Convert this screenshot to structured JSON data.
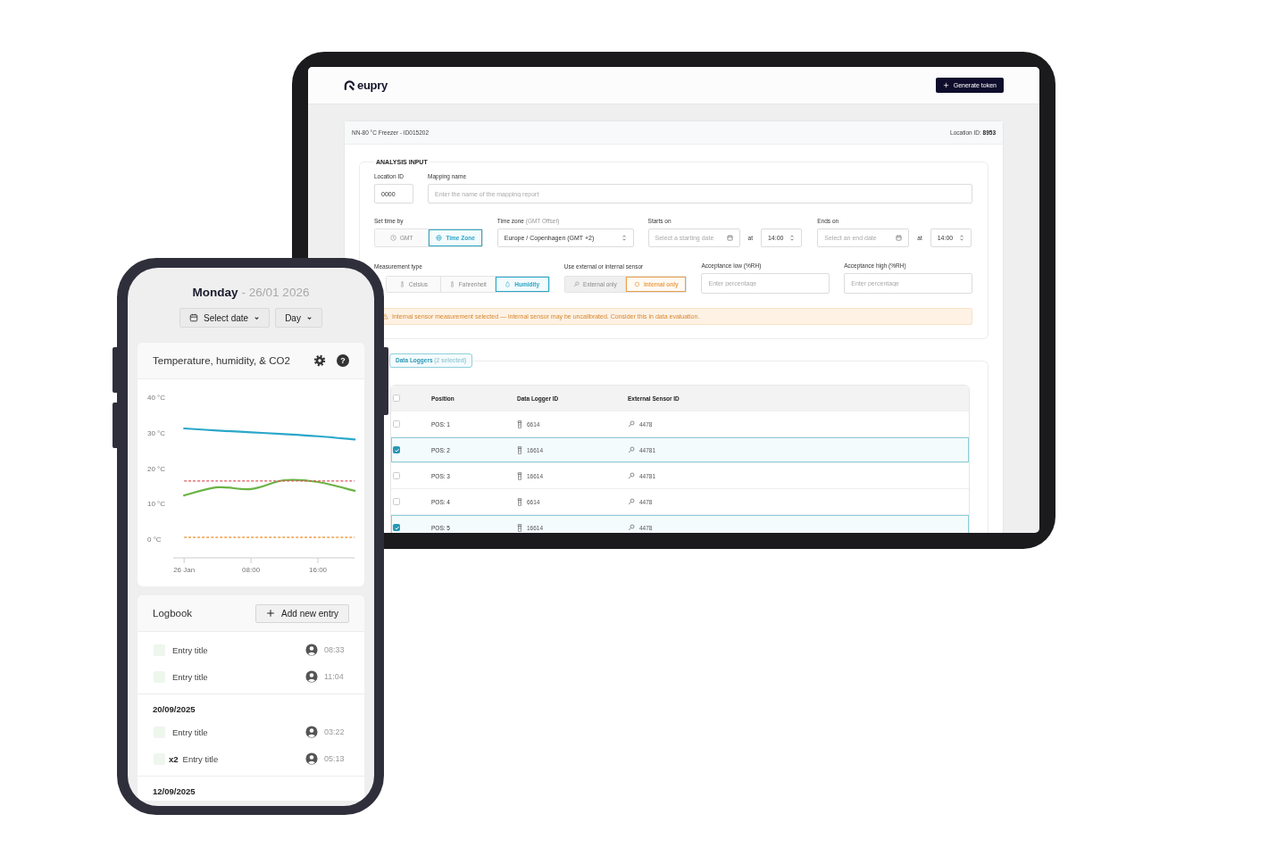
{
  "tablet": {
    "header": {
      "logo": "eupry",
      "button": "Generate token"
    },
    "card": {
      "title": "NN-80 °C Freezer - ID015202",
      "location": "Location ID: **8953**"
    },
    "analysis": {
      "legend": "ANALYSIS INPUT",
      "location_id": {
        "label": "Location ID",
        "value": "0000"
      },
      "mapping_name": {
        "label": "Mapping name",
        "placeholder": "Enter the name of the mapping report"
      },
      "set_time_by": {
        "label": "Set time by",
        "options": [
          {
            "kind": "clock",
            "label": "GMT",
            "selected": false
          },
          {
            "kind": "globe",
            "label": "Time Zone",
            "selected": true
          }
        ]
      },
      "time_zone": {
        "label": "Time zone",
        "note": "(GMT Offset)",
        "value": "Europe / Copenhagen (GMT +2)"
      },
      "starts_on": {
        "label": "Starts on",
        "placeholder": "Select a starting date",
        "at": "at",
        "time": "14:00"
      },
      "ends_on": {
        "label": "Ends on",
        "placeholder": "Select an end date",
        "at": "at",
        "time": "14:00"
      },
      "measurement_type": {
        "label": "Measurement type",
        "options": [
          {
            "kind": "thermometer",
            "label": "Celsius",
            "selected": false
          },
          {
            "kind": "thermometer",
            "label": "Fahrenheit",
            "selected": false
          },
          {
            "kind": "drop",
            "label": "Humidity",
            "selected": true
          }
        ]
      },
      "sensor": {
        "label": "Use external or internal sensor",
        "options": [
          {
            "kind": "probe",
            "label": "External only",
            "selected": false
          },
          {
            "kind": "chip",
            "label": "Internal only",
            "selected": true
          }
        ]
      },
      "acceptance_low": {
        "label": "Acceptance low (%RH)",
        "placeholder": "Enter percentage"
      },
      "acceptance_high": {
        "label": "Acceptance high (%RH)",
        "placeholder": "Enter percentage"
      },
      "warning": "Internal sensor measurement selected — internal sensor may be uncalibrated. Consider this in data evaluation."
    },
    "loggers": {
      "tab": "Data Loggers",
      "tab_note": "(2 selected)",
      "header_checked": false,
      "columns": [
        "Position",
        "Data Logger ID",
        "External Sensor ID"
      ],
      "rows": [
        {
          "position": "POS: 1",
          "logger_id": "6614",
          "sensor_id": "4478",
          "selected": false
        },
        {
          "position": "POS: 2",
          "logger_id": "16614",
          "sensor_id": "44781",
          "selected": true
        },
        {
          "position": "POS: 3",
          "logger_id": "16614",
          "sensor_id": "44781",
          "selected": false
        },
        {
          "position": "POS: 4",
          "logger_id": "6614",
          "sensor_id": "4478",
          "selected": false
        },
        {
          "position": "POS: 5",
          "logger_id": "16614",
          "sensor_id": "4478",
          "selected": true
        }
      ]
    }
  },
  "phone": {
    "day": "Monday",
    "date": "- 26/01 2026",
    "date_button": "Select date",
    "range_button": "Day",
    "chart_card": {
      "title": "Temperature, humidity, & CO2",
      "help": "?",
      "chart_data": {
        "type": "line",
        "x": [
          0,
          4,
          8,
          12,
          16,
          20.4
        ],
        "series": [
          {
            "color": "#2aa7c9",
            "values": [
              31.2,
              30.6,
              30.1,
              29.6,
              29.0,
              28.1
            ]
          },
          {
            "color": "#6ab344",
            "values": [
              12.3,
              14.6,
              14.1,
              16.6,
              16.1,
              13.6
            ]
          },
          {
            "color": "#e0575b",
            "line_style": "dashed",
            "values": [
              16.4,
              16.4,
              16.4,
              16.4,
              16.4,
              16.4
            ]
          },
          {
            "color": "#f0a04b",
            "line_style": "dashed",
            "values": [
              0.5,
              0.5,
              0.5,
              0.5,
              0.5,
              0.5
            ]
          }
        ],
        "xlim": [
          -1.3,
          20.4
        ],
        "ylim": [
          0,
          40
        ],
        "xticks": [
          {
            "value": 0,
            "label": "26 Jan"
          },
          {
            "value": 8,
            "label": "08:00"
          },
          {
            "value": 16,
            "label": "16:00"
          }
        ],
        "yticks": [
          {
            "value": 0,
            "label": "0 °C"
          },
          {
            "value": 10,
            "label": "10 °C"
          },
          {
            "value": 20,
            "label": "20 °C"
          },
          {
            "value": 30,
            "label": "30 °C"
          },
          {
            "value": 40,
            "label": "40 °C"
          }
        ]
      }
    },
    "logbook": {
      "title": "Logbook",
      "add_button": "Add new entry",
      "groups": [
        {
          "entries": [
            {
              "title": "Entry title",
              "time": "08:33"
            },
            {
              "title": "Entry title",
              "time": "11:04"
            }
          ]
        },
        {
          "date": "20/09/2025",
          "entries": [
            {
              "title": "Entry title",
              "time": "03:22"
            },
            {
              "count": "x2",
              "title": "Entry title",
              "time": "05:13"
            }
          ]
        },
        {
          "date": "12/09/2025"
        }
      ]
    }
  }
}
